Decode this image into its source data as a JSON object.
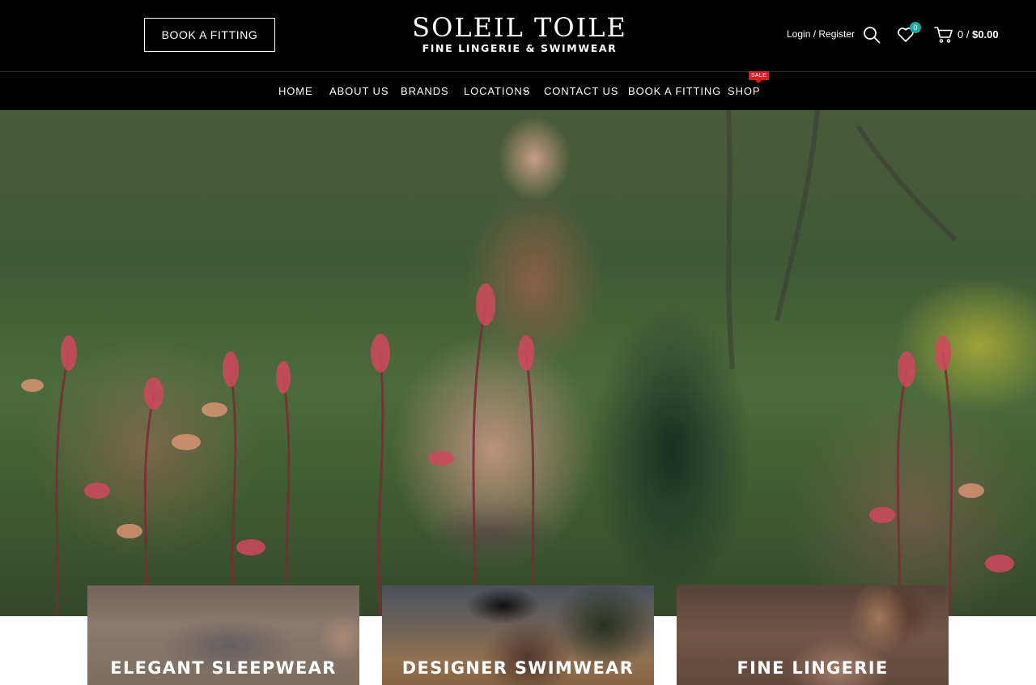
{
  "header": {
    "book_button": "BOOK A FITTING",
    "logo_title": "SOLEIL TOILE",
    "logo_subtitle": "FINE LINGERIE & SWIMWEAR",
    "login_link": "Login / Register",
    "wishlist_count": "0",
    "cart_count": "0 /",
    "cart_total": "$0.00"
  },
  "nav": {
    "items": [
      "HOME",
      "ABOUT US",
      "BRANDS",
      "LOCATIONS",
      "CONTACT US",
      "BOOK A FITTING",
      "SHOP"
    ],
    "sale_badge": "SALE"
  },
  "categories": [
    {
      "label": "ELEGANT SLEEPWEAR"
    },
    {
      "label": "DESIGNER SWIMWEAR"
    },
    {
      "label": "FINE LINGERIE"
    }
  ],
  "colors": {
    "header_bg": "#000000",
    "sale_badge": "#e21c22",
    "wishlist_badge": "#1fa7a1"
  },
  "icons": {
    "search": "search-icon",
    "wishlist": "heart-icon",
    "cart": "cart-icon",
    "dropdown": "chevron-down-icon"
  }
}
